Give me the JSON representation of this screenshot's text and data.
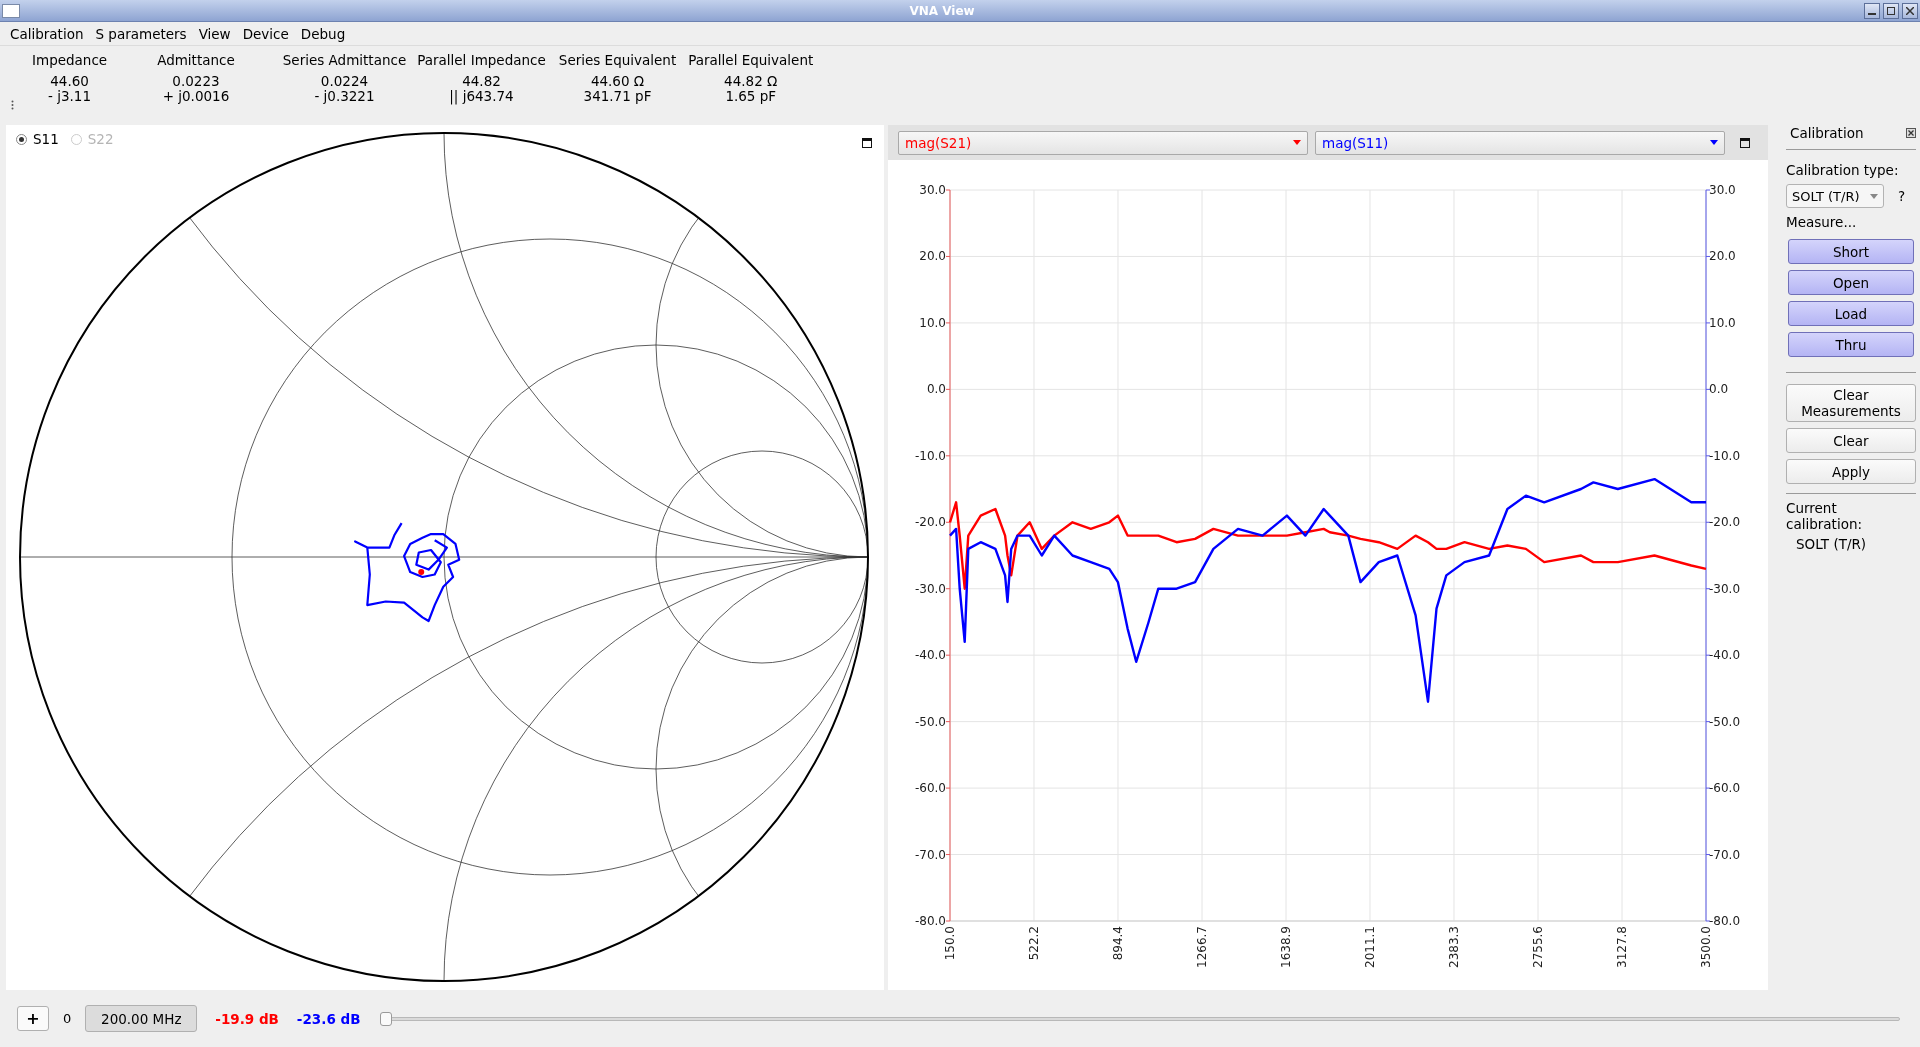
{
  "window": {
    "title": "VNA View"
  },
  "menu": [
    "Calibration",
    "S parameters",
    "View",
    "Device",
    "Debug"
  ],
  "readouts": [
    {
      "label": "Impedance",
      "line_1": "44.60",
      "line_2": "- j3.11"
    },
    {
      "label": "Admittance",
      "line_1": "0.0223",
      "line_2": "+ j0.0016"
    },
    {
      "label": "Series Admittance",
      "line_1": "0.0224",
      "line_2": "- j0.3221"
    },
    {
      "label": "Parallel Impedance",
      "line_1": "44.82",
      "line_2": "|| j643.74"
    },
    {
      "label": "Series Equivalent",
      "line_1": "44.60 Ω",
      "line_2": "341.71 pF"
    },
    {
      "label": "Parallel Equivalent",
      "line_1": "44.82 Ω",
      "line_2": "1.65 pF"
    }
  ],
  "smith": {
    "ports": [
      {
        "label": "S11",
        "selected": true,
        "disabled": false
      },
      {
        "label": "S22",
        "selected": false,
        "disabled": true
      }
    ]
  },
  "chart": {
    "chart_data": {
      "type": "line",
      "grid": true,
      "x": [
        150,
        177,
        193,
        215,
        231,
        286,
        351,
        394,
        405,
        421,
        449,
        503,
        557,
        612,
        693,
        774,
        856,
        894,
        937,
        975,
        1030,
        1073,
        1154,
        1236,
        1317,
        1426,
        1535,
        1643,
        1725,
        1806,
        1833,
        1915,
        1969,
        2050,
        2132,
        2213,
        2268,
        2306,
        2349,
        2430,
        2539,
        2620,
        2702,
        2783,
        2946,
        3001,
        3109,
        3272,
        3435,
        3500
      ],
      "series": [
        {
          "name": "mag(S21)",
          "color": "#ff0000",
          "values": [
            -20,
            -17,
            -22,
            -30,
            -22,
            -19,
            -18,
            -22,
            -25,
            -28,
            -22,
            -20,
            -24,
            -22,
            -20,
            -21,
            -20,
            -19,
            -22,
            -22,
            -22,
            -22,
            -23,
            -22.5,
            -21,
            -22,
            -22,
            -22,
            -21.5,
            -21,
            -21.5,
            -22,
            -22.5,
            -23,
            -24,
            -22,
            -23,
            -24,
            -24,
            -23,
            -24,
            -23.5,
            -24,
            -26,
            -25,
            -26,
            -26,
            -25,
            -26.5,
            -27
          ]
        },
        {
          "name": "mag(S11)",
          "color": "#0000ff",
          "values": [
            -22,
            -21,
            -30,
            -38,
            -24,
            -23,
            -24,
            -28,
            -32,
            -24,
            -22,
            -22,
            -25,
            -22,
            -25,
            -26,
            -27,
            -29,
            -36,
            -41,
            -35,
            -30,
            -30,
            -29,
            -24,
            -21,
            -22,
            -19,
            -22,
            -18,
            -19,
            -22,
            -29,
            -26,
            -25,
            -34,
            -47,
            -33,
            -28,
            -26,
            -25,
            -18,
            -16,
            -17,
            -15,
            -14,
            -15,
            -13.5,
            -17,
            -17
          ]
        }
      ],
      "xlim": [
        150,
        3500
      ],
      "ylim": [
        -80,
        30
      ],
      "xticks": [
        {
          "value": 150,
          "label": "150.0"
        },
        {
          "value": 522.2,
          "label": "522.2"
        },
        {
          "value": 894.4,
          "label": "894.4"
        },
        {
          "value": 1266.7,
          "label": "1266.7"
        },
        {
          "value": 1638.9,
          "label": "1638.9"
        },
        {
          "value": 2011.1,
          "label": "2011.1"
        },
        {
          "value": 2383.3,
          "label": "2383.3"
        },
        {
          "value": 2755.6,
          "label": "2755.6"
        },
        {
          "value": 3127.8,
          "label": "3127.8"
        },
        {
          "value": 3500,
          "label": "3500.0"
        }
      ],
      "yticks": [
        {
          "value": 30,
          "label": "30.0"
        },
        {
          "value": 20,
          "label": "20.0"
        },
        {
          "value": 10,
          "label": "10.0"
        },
        {
          "value": 0,
          "label": "0.0"
        },
        {
          "value": -10,
          "label": "-10.0"
        },
        {
          "value": -20,
          "label": "-20.0"
        },
        {
          "value": -30,
          "label": "-30.0"
        },
        {
          "value": -40,
          "label": "-40.0"
        },
        {
          "value": -50,
          "label": "-50.0"
        },
        {
          "value": -60,
          "label": "-60.0"
        },
        {
          "value": -70,
          "label": "-70.0"
        },
        {
          "value": -80,
          "label": "-80.0"
        }
      ]
    }
  },
  "calibration": {
    "title": "Calibration",
    "type_label": "Calibration type:",
    "type_value": "SOLT (T/R)",
    "help": "?",
    "measure_label": "Measure...",
    "measure_buttons": [
      "Short",
      "Open",
      "Load",
      "Thru"
    ],
    "action_buttons": [
      "Clear Measurements",
      "Clear",
      "Apply"
    ],
    "current_label": "Current calibration:",
    "current_value": "SOLT (T/R)"
  },
  "bottom": {
    "add": "+",
    "index": "0",
    "frequency": "200.00 MHz",
    "readings": [
      {
        "text": "-19.9 dB",
        "color": "#ff0000"
      },
      {
        "text": "-23.6 dB",
        "color": "#0000ff"
      }
    ],
    "slider": {
      "level": 0
    }
  }
}
